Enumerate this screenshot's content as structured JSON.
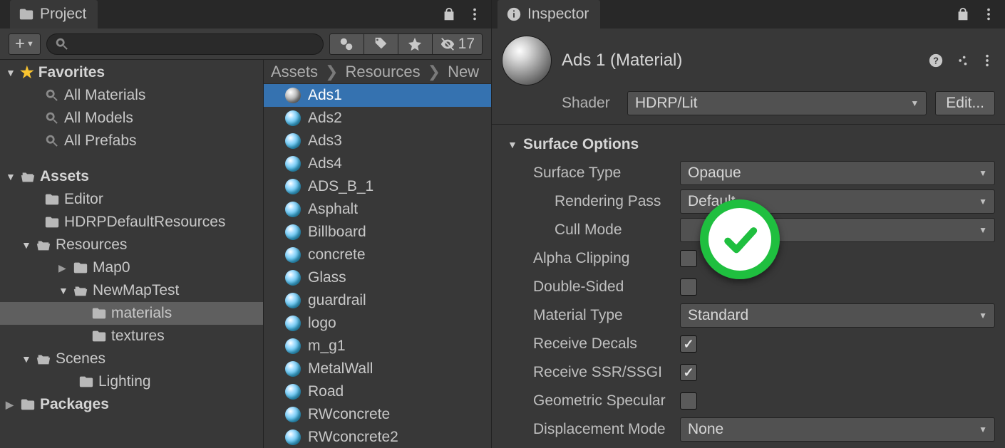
{
  "project": {
    "tab_label": "Project",
    "search_placeholder": "",
    "hidden_count": "17",
    "tree": {
      "favorites_label": "Favorites",
      "fav_items": [
        "All Materials",
        "All Models",
        "All Prefabs"
      ],
      "assets_label": "Assets",
      "assets_children": {
        "editor": "Editor",
        "hdrp": "HDRPDefaultResources",
        "resources": "Resources",
        "map0": "Map0",
        "newmaptest": "NewMapTest",
        "materials": "materials",
        "textures": "textures",
        "scenes": "Scenes",
        "lighting": "Lighting"
      },
      "packages_label": "Packages"
    },
    "breadcrumb": [
      "Assets",
      "Resources",
      "New"
    ],
    "assets": [
      "Ads1",
      "Ads2",
      "Ads3",
      "Ads4",
      "ADS_B_1",
      "Asphalt",
      "Billboard",
      "concrete",
      "Glass",
      "guardrail",
      "logo",
      "m_g1",
      "MetalWall",
      "Road",
      "RWconcrete",
      "RWconcrete2"
    ],
    "selected_asset_index": 0
  },
  "inspector": {
    "tab_label": "Inspector",
    "title": "Ads 1 (Material)",
    "shader_label": "Shader",
    "shader_value": "HDRP/Lit",
    "edit_label": "Edit...",
    "section_title": "Surface Options",
    "props": {
      "surface_type": {
        "label": "Surface Type",
        "value": "Opaque"
      },
      "rendering_pass": {
        "label": "Rendering Pass",
        "value": "Default"
      },
      "cull_mode": {
        "label": "Cull Mode",
        "value": ""
      },
      "alpha_clipping": {
        "label": "Alpha Clipping",
        "checked": false
      },
      "double_sided": {
        "label": "Double-Sided",
        "checked": false
      },
      "material_type": {
        "label": "Material Type",
        "value": "Standard"
      },
      "receive_decals": {
        "label": "Receive Decals",
        "checked": true
      },
      "receive_ssr": {
        "label": "Receive SSR/SSGI",
        "checked": true
      },
      "geometric_specular": {
        "label": "Geometric Specular",
        "checked": false
      },
      "displacement_mode": {
        "label": "Displacement Mode",
        "value": "None"
      }
    }
  }
}
